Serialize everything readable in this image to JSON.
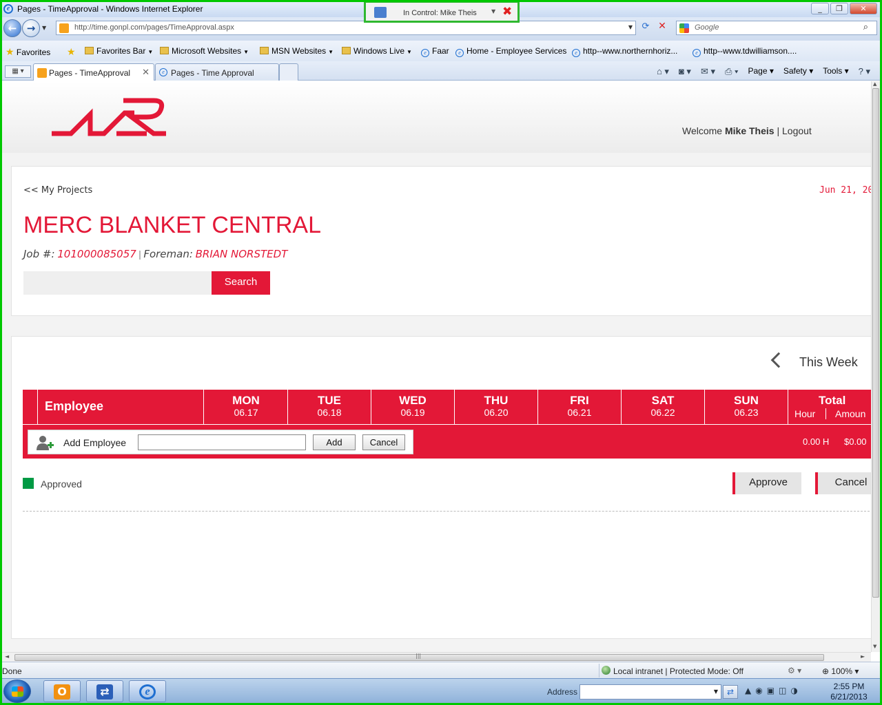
{
  "window": {
    "title": "Pages - TimeApproval - Windows Internet Explorer",
    "control_badge": "In Control: Mike Theis"
  },
  "address_bar": {
    "url": "http://time.gonpl.com/pages/TimeApproval.aspx",
    "search_placeholder": "Google"
  },
  "favorites": {
    "favorites_label": "Favorites",
    "items": [
      "Favorites Bar",
      "Microsoft Websites",
      "MSN Websites",
      "Windows Live",
      "Faar",
      "Home - Employee Services",
      "http--www.northernhoriz...",
      "http--www.tdwilliamson...."
    ]
  },
  "tabs": [
    {
      "label": "Pages - TimeApproval"
    },
    {
      "label": "Pages - Time Approval"
    }
  ],
  "command_bar": {
    "page": "Page",
    "safety": "Safety",
    "tools": "Tools"
  },
  "header": {
    "welcome_prefix": "Welcome",
    "user_name": "Mike Theis",
    "separator": "|",
    "logout": "Logout"
  },
  "project": {
    "back_link": "<< My Projects",
    "date": "Jun 21, 20",
    "title": "MERC BLANKET CENTRAL",
    "job_label": "Job #:",
    "job_number": "101000085057",
    "separator": "|",
    "foreman_label": "Foreman:",
    "foreman_name": "BRIAN NORSTEDT",
    "search_button": "Search"
  },
  "timesheet": {
    "week_label": "This Week",
    "employee_header": "Employee",
    "days": [
      {
        "day": "MON",
        "date": "06.17"
      },
      {
        "day": "TUE",
        "date": "06.18"
      },
      {
        "day": "WED",
        "date": "06.19"
      },
      {
        "day": "THU",
        "date": "06.20"
      },
      {
        "day": "FRI",
        "date": "06.21"
      },
      {
        "day": "SAT",
        "date": "06.22"
      },
      {
        "day": "SUN",
        "date": "06.23"
      }
    ],
    "total_header": "Total",
    "hour_header": "Hour",
    "amount_header": "Amoun",
    "add_employee_label": "Add Employee",
    "add_button": "Add",
    "cancel_button": "Cancel",
    "total_hours": "0.00 H",
    "total_amount": "$0.00",
    "legend_approved": "Approved",
    "approve_button": "Approve",
    "cancel_action_button": "Cancel",
    "colors": {
      "accent": "#e31837",
      "approved": "#009a44"
    }
  },
  "status_bar": {
    "left": "Done",
    "zone": "Local intranet | Protected Mode: Off",
    "zoom": "100%"
  },
  "taskbar": {
    "address_label": "Address",
    "time": "2:55 PM",
    "date": "6/21/2013"
  }
}
